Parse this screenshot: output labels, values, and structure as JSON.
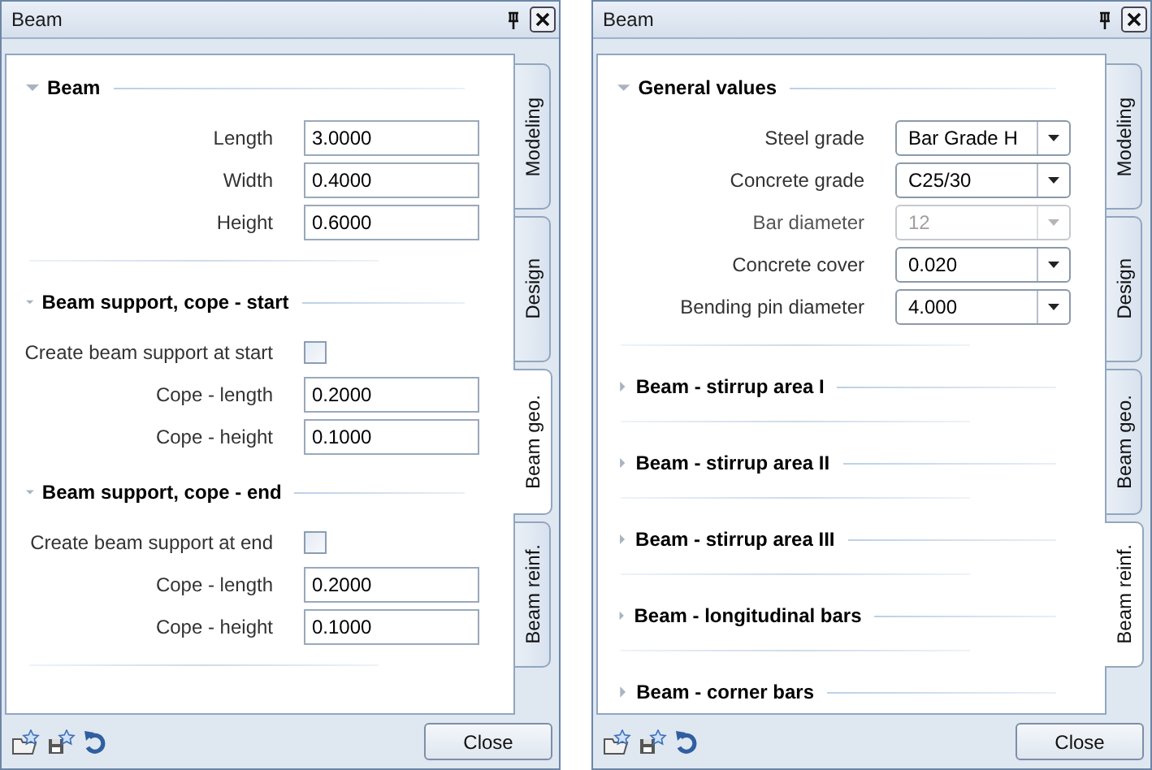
{
  "windows": [
    {
      "title": "Beam",
      "tabs": [
        {
          "label": "Modeling",
          "selected": false
        },
        {
          "label": "Design",
          "selected": false
        },
        {
          "label": "Beam geo.",
          "selected": true
        },
        {
          "label": "Beam reinf.",
          "selected": false
        }
      ],
      "sections": [
        {
          "title": "Beam",
          "expanded": true,
          "divider": true,
          "rows": [
            {
              "kind": "text",
              "label": "Length",
              "value": "3.0000"
            },
            {
              "kind": "text",
              "label": "Width",
              "value": "0.4000"
            },
            {
              "kind": "text",
              "label": "Height",
              "value": "0.6000"
            }
          ]
        },
        {
          "title": "Beam support, cope - start",
          "expanded": true,
          "divider": false,
          "rows": [
            {
              "kind": "checkbox",
              "label": "Create beam support at start",
              "checked": false
            },
            {
              "kind": "text",
              "label": "Cope - length",
              "value": "0.2000"
            },
            {
              "kind": "text",
              "label": "Cope - height",
              "value": "0.1000"
            }
          ]
        },
        {
          "title": "Beam support, cope - end",
          "expanded": true,
          "divider": true,
          "rows": [
            {
              "kind": "checkbox",
              "label": "Create beam support at end",
              "checked": false
            },
            {
              "kind": "text",
              "label": "Cope - length",
              "value": "0.2000"
            },
            {
              "kind": "text",
              "label": "Cope - height",
              "value": "0.1000"
            }
          ]
        }
      ],
      "button": "Close"
    },
    {
      "title": "Beam",
      "tabs": [
        {
          "label": "Modeling",
          "selected": false
        },
        {
          "label": "Design",
          "selected": false
        },
        {
          "label": "Beam geo.",
          "selected": false
        },
        {
          "label": "Beam reinf.",
          "selected": true
        }
      ],
      "sections": [
        {
          "title": "General values",
          "expanded": true,
          "divider": true,
          "rows": [
            {
              "kind": "combo",
              "label": "Steel grade",
              "value": "Bar Grade H",
              "disabled": false
            },
            {
              "kind": "combo",
              "label": "Concrete grade",
              "value": "C25/30",
              "disabled": false
            },
            {
              "kind": "combo",
              "label": "Bar diameter",
              "value": "12",
              "disabled": true
            },
            {
              "kind": "combo",
              "label": "Concrete cover",
              "value": "0.020",
              "disabled": false
            },
            {
              "kind": "combo",
              "label": "Bending pin diameter",
              "value": "4.000",
              "disabled": false
            }
          ]
        },
        {
          "title": "Beam - stirrup area I",
          "expanded": false,
          "divider": true
        },
        {
          "title": "Beam - stirrup area II",
          "expanded": false,
          "divider": true
        },
        {
          "title": "Beam - stirrup area III",
          "expanded": false,
          "divider": true
        },
        {
          "title": "Beam - longitudinal bars",
          "expanded": false,
          "divider": true
        },
        {
          "title": "Beam - corner bars",
          "expanded": false,
          "divider": false
        }
      ],
      "button": "Close"
    }
  ]
}
